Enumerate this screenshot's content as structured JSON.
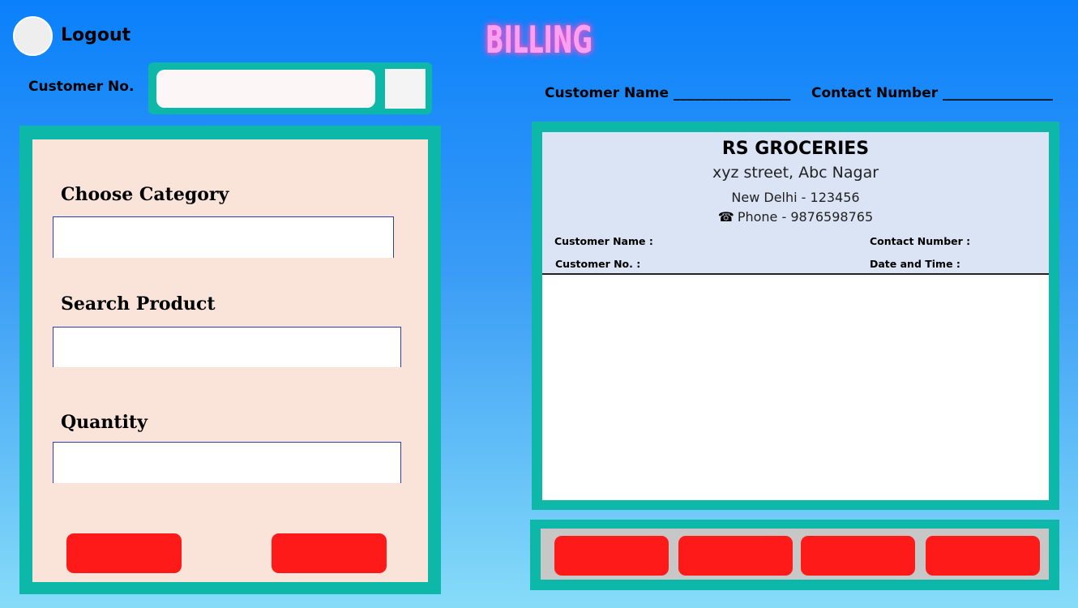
{
  "header": {
    "logout_label": "Logout",
    "title": "BILLING"
  },
  "customer_lookup": {
    "label": "Customer No.",
    "input_value": "",
    "input_placeholder": ""
  },
  "customer_info": {
    "name_field": "Customer Name _________________",
    "contact_field": "Contact Number ________________"
  },
  "product_form": {
    "category_label": "Choose Category",
    "category_value": "",
    "search_label": "Search Product",
    "search_value": "",
    "quantity_label": "Quantity",
    "quantity_value": "",
    "buttons": [
      "",
      ""
    ]
  },
  "bill": {
    "shop_name": "RS GROCERIES",
    "street": "xyz street, Abc Nagar",
    "city": "New Delhi - 123456",
    "phone_icon": "☎",
    "phone": "Phone - 9876598765",
    "meta": {
      "customer_name": "Customer Name :",
      "contact_number": "Contact Number :",
      "customer_no": "Customer No. :",
      "date_time": "Date and Time :"
    }
  },
  "bottom_buttons": [
    "",
    "",
    "",
    ""
  ],
  "colors": {
    "teal": "#0db8a8",
    "red_button": "#ff1a1a",
    "title_pink": "#f7a1f0",
    "panel_peach": "#fae4da",
    "bill_header": "#dbe4f5"
  }
}
